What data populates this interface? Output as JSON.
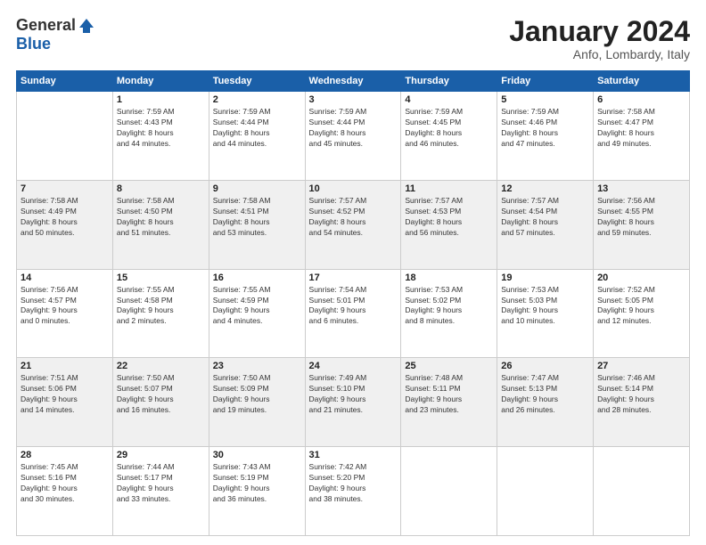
{
  "logo": {
    "general": "General",
    "blue": "Blue"
  },
  "header": {
    "month": "January 2024",
    "location": "Anfo, Lombardy, Italy"
  },
  "weekdays": [
    "Sunday",
    "Monday",
    "Tuesday",
    "Wednesday",
    "Thursday",
    "Friday",
    "Saturday"
  ],
  "weeks": [
    [
      {
        "day": "",
        "content": ""
      },
      {
        "day": "1",
        "content": "Sunrise: 7:59 AM\nSunset: 4:43 PM\nDaylight: 8 hours\nand 44 minutes."
      },
      {
        "day": "2",
        "content": "Sunrise: 7:59 AM\nSunset: 4:44 PM\nDaylight: 8 hours\nand 44 minutes."
      },
      {
        "day": "3",
        "content": "Sunrise: 7:59 AM\nSunset: 4:44 PM\nDaylight: 8 hours\nand 45 minutes."
      },
      {
        "day": "4",
        "content": "Sunrise: 7:59 AM\nSunset: 4:45 PM\nDaylight: 8 hours\nand 46 minutes."
      },
      {
        "day": "5",
        "content": "Sunrise: 7:59 AM\nSunset: 4:46 PM\nDaylight: 8 hours\nand 47 minutes."
      },
      {
        "day": "6",
        "content": "Sunrise: 7:58 AM\nSunset: 4:47 PM\nDaylight: 8 hours\nand 49 minutes."
      }
    ],
    [
      {
        "day": "7",
        "content": "Sunrise: 7:58 AM\nSunset: 4:49 PM\nDaylight: 8 hours\nand 50 minutes."
      },
      {
        "day": "8",
        "content": "Sunrise: 7:58 AM\nSunset: 4:50 PM\nDaylight: 8 hours\nand 51 minutes."
      },
      {
        "day": "9",
        "content": "Sunrise: 7:58 AM\nSunset: 4:51 PM\nDaylight: 8 hours\nand 53 minutes."
      },
      {
        "day": "10",
        "content": "Sunrise: 7:57 AM\nSunset: 4:52 PM\nDaylight: 8 hours\nand 54 minutes."
      },
      {
        "day": "11",
        "content": "Sunrise: 7:57 AM\nSunset: 4:53 PM\nDaylight: 8 hours\nand 56 minutes."
      },
      {
        "day": "12",
        "content": "Sunrise: 7:57 AM\nSunset: 4:54 PM\nDaylight: 8 hours\nand 57 minutes."
      },
      {
        "day": "13",
        "content": "Sunrise: 7:56 AM\nSunset: 4:55 PM\nDaylight: 8 hours\nand 59 minutes."
      }
    ],
    [
      {
        "day": "14",
        "content": "Sunrise: 7:56 AM\nSunset: 4:57 PM\nDaylight: 9 hours\nand 0 minutes."
      },
      {
        "day": "15",
        "content": "Sunrise: 7:55 AM\nSunset: 4:58 PM\nDaylight: 9 hours\nand 2 minutes."
      },
      {
        "day": "16",
        "content": "Sunrise: 7:55 AM\nSunset: 4:59 PM\nDaylight: 9 hours\nand 4 minutes."
      },
      {
        "day": "17",
        "content": "Sunrise: 7:54 AM\nSunset: 5:01 PM\nDaylight: 9 hours\nand 6 minutes."
      },
      {
        "day": "18",
        "content": "Sunrise: 7:53 AM\nSunset: 5:02 PM\nDaylight: 9 hours\nand 8 minutes."
      },
      {
        "day": "19",
        "content": "Sunrise: 7:53 AM\nSunset: 5:03 PM\nDaylight: 9 hours\nand 10 minutes."
      },
      {
        "day": "20",
        "content": "Sunrise: 7:52 AM\nSunset: 5:05 PM\nDaylight: 9 hours\nand 12 minutes."
      }
    ],
    [
      {
        "day": "21",
        "content": "Sunrise: 7:51 AM\nSunset: 5:06 PM\nDaylight: 9 hours\nand 14 minutes."
      },
      {
        "day": "22",
        "content": "Sunrise: 7:50 AM\nSunset: 5:07 PM\nDaylight: 9 hours\nand 16 minutes."
      },
      {
        "day": "23",
        "content": "Sunrise: 7:50 AM\nSunset: 5:09 PM\nDaylight: 9 hours\nand 19 minutes."
      },
      {
        "day": "24",
        "content": "Sunrise: 7:49 AM\nSunset: 5:10 PM\nDaylight: 9 hours\nand 21 minutes."
      },
      {
        "day": "25",
        "content": "Sunrise: 7:48 AM\nSunset: 5:11 PM\nDaylight: 9 hours\nand 23 minutes."
      },
      {
        "day": "26",
        "content": "Sunrise: 7:47 AM\nSunset: 5:13 PM\nDaylight: 9 hours\nand 26 minutes."
      },
      {
        "day": "27",
        "content": "Sunrise: 7:46 AM\nSunset: 5:14 PM\nDaylight: 9 hours\nand 28 minutes."
      }
    ],
    [
      {
        "day": "28",
        "content": "Sunrise: 7:45 AM\nSunset: 5:16 PM\nDaylight: 9 hours\nand 30 minutes."
      },
      {
        "day": "29",
        "content": "Sunrise: 7:44 AM\nSunset: 5:17 PM\nDaylight: 9 hours\nand 33 minutes."
      },
      {
        "day": "30",
        "content": "Sunrise: 7:43 AM\nSunset: 5:19 PM\nDaylight: 9 hours\nand 36 minutes."
      },
      {
        "day": "31",
        "content": "Sunrise: 7:42 AM\nSunset: 5:20 PM\nDaylight: 9 hours\nand 38 minutes."
      },
      {
        "day": "",
        "content": ""
      },
      {
        "day": "",
        "content": ""
      },
      {
        "day": "",
        "content": ""
      }
    ]
  ]
}
